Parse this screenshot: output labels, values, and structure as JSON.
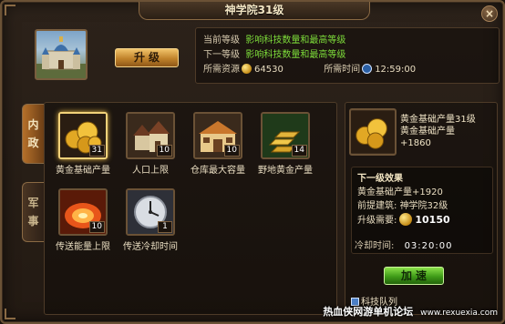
{
  "window": {
    "title": "神学院31级",
    "close_glyph": "×"
  },
  "header": {
    "upgrade_label": "升级",
    "current_level_label": "当前等级",
    "current_level_value": "影响科技数量和最高等级",
    "next_level_label": "下一等级",
    "next_level_value": "影响科技数量和最高等级",
    "required_resources_label": "所需资源",
    "required_resources_value": "64530",
    "required_time_label": "所需时间",
    "required_time_value": "12:59:00"
  },
  "tabs": [
    {
      "label": "内\n政",
      "active": true
    },
    {
      "label": "军\n事",
      "active": false
    }
  ],
  "tiles": [
    {
      "name": "黄金基础产量",
      "level": "31",
      "icon": "gold-coins-icon",
      "selected": true
    },
    {
      "name": "人口上限",
      "level": "10",
      "icon": "houses-icon",
      "selected": false
    },
    {
      "name": "仓库最大容量",
      "level": "10",
      "icon": "warehouse-icon",
      "selected": false
    },
    {
      "name": "野地黄金产量",
      "level": "14",
      "icon": "gold-bars-icon",
      "selected": false
    },
    {
      "name": "传送能量上限",
      "level": "10",
      "icon": "portal-energy-icon",
      "selected": false
    },
    {
      "name": "传送冷却时间",
      "level": "1",
      "icon": "clock-icon",
      "selected": false
    }
  ],
  "detail": {
    "title": "黄金基础产量31级",
    "desc": "黄金基础产量",
    "bonus": "+1860",
    "next_effect_label": "下一级效果",
    "next_effect_value": "黄金基础产量+1920",
    "prereq_label": "前提建筑:",
    "prereq_value": "神学院32级",
    "cost_label": "升级需要:",
    "cost_value": "10150",
    "cooldown_label": "冷却时间:",
    "cooldown_value": "03:20:00",
    "speed_label": "加速",
    "footer_note": "科技队列"
  },
  "watermark": {
    "main": "热血侠网游单机论坛",
    "url": "www.rexuexia.com"
  },
  "colors": {
    "accent_green": "#7ddc3a",
    "gold_button": "#c0822a",
    "frame": "#6b5236"
  }
}
